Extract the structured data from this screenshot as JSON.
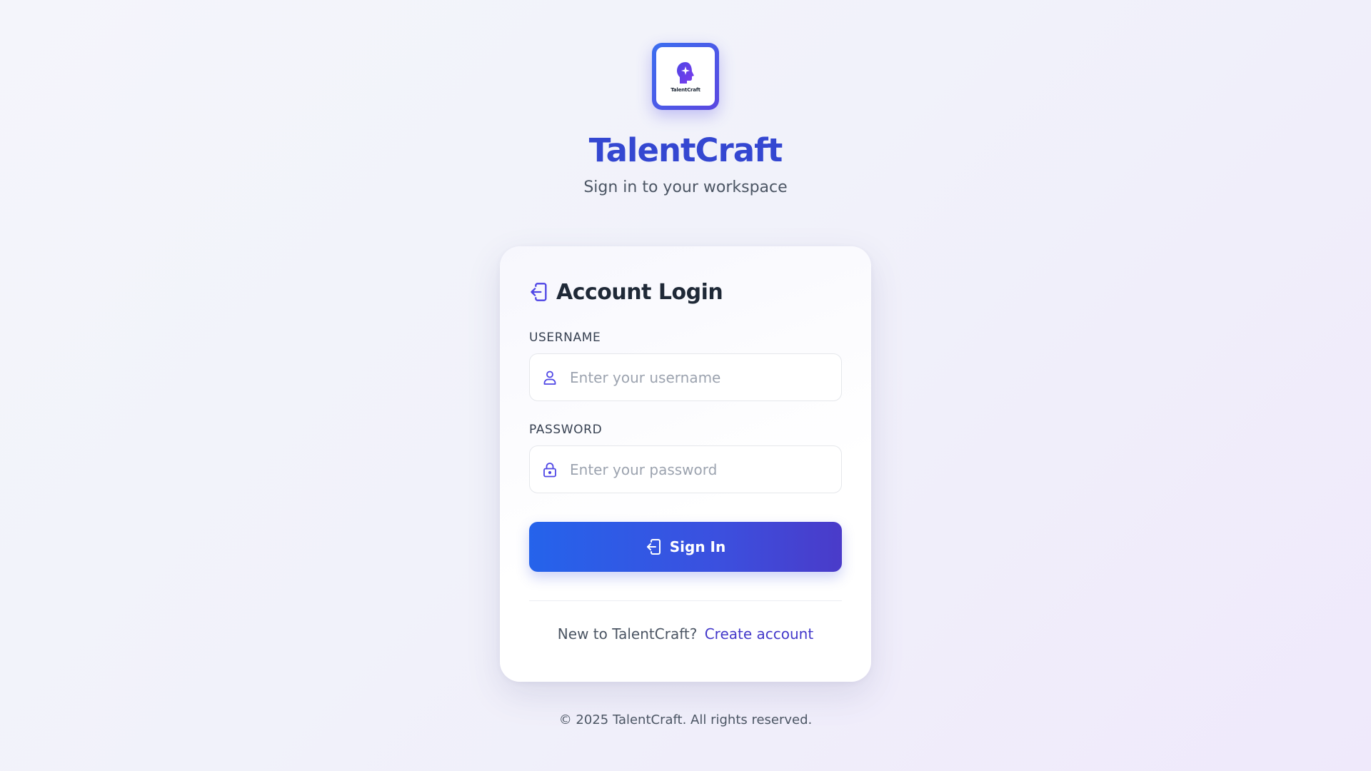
{
  "brand": {
    "logo_text": "TalentCraft",
    "title": "TalentCraft",
    "subtitle": "Sign in to your workspace"
  },
  "login_card": {
    "title": "Account Login",
    "title_icon": "login-icon",
    "username": {
      "label": "USERNAME",
      "placeholder": "Enter your username",
      "value": "",
      "icon": "user-icon"
    },
    "password": {
      "label": "PASSWORD",
      "placeholder": "Enter your password",
      "value": "",
      "icon": "lock-icon"
    },
    "signin_button": {
      "label": "Sign In",
      "icon": "login-icon"
    },
    "signup": {
      "prompt": "New to TalentCraft?",
      "link_label": "Create account"
    }
  },
  "footer": {
    "text": "© 2025 TalentCraft. All rights reserved."
  },
  "colors": {
    "brand_title": "#3447d1",
    "accent": "#4f46e5",
    "button_start": "#2563eb",
    "button_end": "#4a3bc9",
    "link": "#4338ca"
  }
}
